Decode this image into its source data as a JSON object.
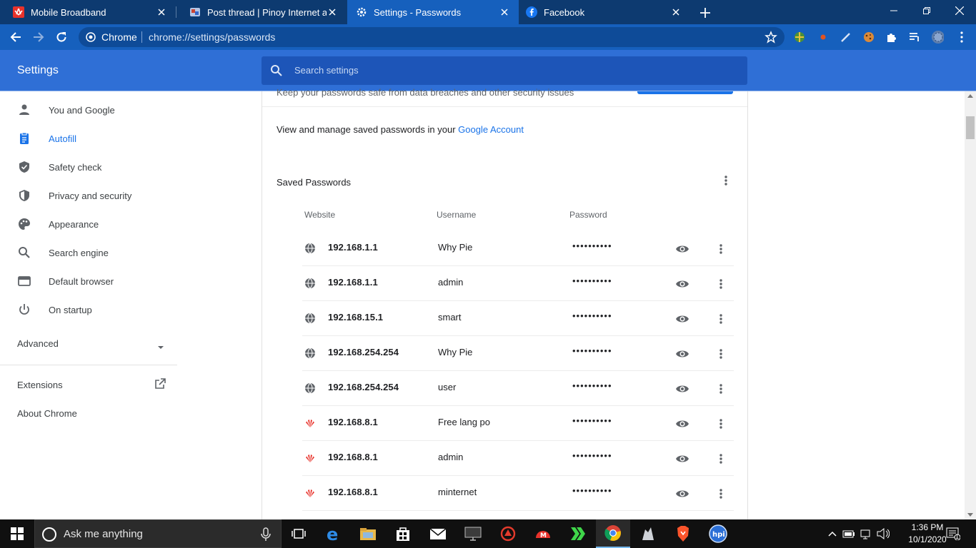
{
  "browser": {
    "tabs": [
      {
        "title": "Mobile Broadband",
        "icon": "huawei-icon",
        "active": false
      },
      {
        "title": "Post thread | Pinoy Internet and T",
        "icon": "forum-icon",
        "active": false
      },
      {
        "title": "Settings - Passwords",
        "icon": "gear-icon",
        "active": true
      },
      {
        "title": "Facebook",
        "icon": "facebook-icon",
        "active": false
      }
    ],
    "omnibox": {
      "site_label": "Chrome",
      "url": "chrome://settings/passwords"
    }
  },
  "settings": {
    "title": "Settings",
    "search_placeholder": "Search settings",
    "nav": [
      {
        "label": "You and Google",
        "icon": "person-icon"
      },
      {
        "label": "Autofill",
        "icon": "clipboard-icon"
      },
      {
        "label": "Safety check",
        "icon": "shield-check-icon"
      },
      {
        "label": "Privacy and security",
        "icon": "shield-icon"
      },
      {
        "label": "Appearance",
        "icon": "palette-icon"
      },
      {
        "label": "Search engine",
        "icon": "search-icon"
      },
      {
        "label": "Default browser",
        "icon": "browser-icon"
      },
      {
        "label": "On startup",
        "icon": "power-icon"
      }
    ],
    "active_nav": "Autofill",
    "advanced_label": "Advanced",
    "extensions_label": "Extensions",
    "about_label": "About Chrome"
  },
  "passwords": {
    "cut_off_text": "Keep your passwords safe from data breaches and other security issues",
    "manage_text": "View and manage saved passwords in your ",
    "manage_link": "Google Account",
    "saved_title": "Saved Passwords",
    "columns": {
      "website": "Website",
      "username": "Username",
      "password": "Password"
    },
    "rows": [
      {
        "site": "192.168.1.1",
        "user": "Why Pie",
        "pass": "••••••••••",
        "favicon": "globe"
      },
      {
        "site": "192.168.1.1",
        "user": "admin",
        "pass": "••••••••••",
        "favicon": "globe"
      },
      {
        "site": "192.168.15.1",
        "user": "smart",
        "pass": "••••••••••",
        "favicon": "globe"
      },
      {
        "site": "192.168.254.254",
        "user": "Why Pie",
        "pass": "••••••••••",
        "favicon": "globe"
      },
      {
        "site": "192.168.254.254",
        "user": "user",
        "pass": "••••••••••",
        "favicon": "globe"
      },
      {
        "site": "192.168.8.1",
        "user": "Free lang po",
        "pass": "••••••••••",
        "favicon": "huawei"
      },
      {
        "site": "192.168.8.1",
        "user": "admin",
        "pass": "••••••••••",
        "favicon": "huawei"
      },
      {
        "site": "192.168.8.1",
        "user": "minternet",
        "pass": "••••••••••",
        "favicon": "huawei"
      }
    ]
  },
  "taskbar": {
    "search_placeholder": "Ask me anything",
    "time": "1:36 PM",
    "date": "10/1/2020",
    "notification_count": "1"
  },
  "colors": {
    "tabstrip": "#0d3a70",
    "toolbar": "#1660bd",
    "header": "#2f6fd6",
    "accent": "#1a73e8",
    "huawei": "#e8322b"
  }
}
